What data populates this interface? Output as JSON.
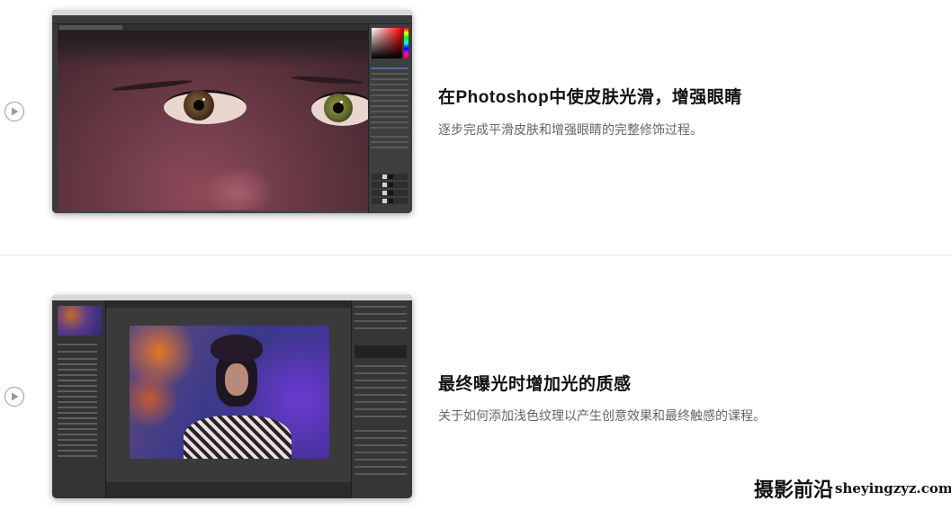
{
  "lessons": [
    {
      "title": "在Photoshop中使皮肤光滑，增强眼睛",
      "description": "逐步完成平滑皮肤和增强眼睛的完整修饰过程。",
      "play_icon": "play-circle-icon",
      "thumbnail_app": "Photoshop"
    },
    {
      "title": "最终曝光时增加光的质感",
      "description": "关于如何添加浅色纹理以产生创意效果和最终触感的课程。",
      "play_icon": "play-circle-icon",
      "thumbnail_app": "Capture One"
    }
  ],
  "watermark": {
    "text_cn": "摄影前沿",
    "text_url": "sheyingzyz.com"
  },
  "colors": {
    "title": "#111111",
    "description": "#666666",
    "divider": "#e6e6e6",
    "play_border": "#9a9a9a"
  }
}
